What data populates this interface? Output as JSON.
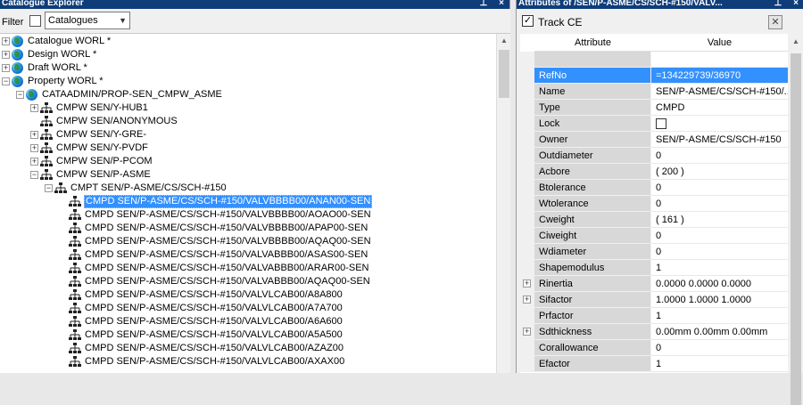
{
  "left_panel": {
    "title": "Catalogue Explorer",
    "pin_glyph": "⊥",
    "close_glyph": "×",
    "filter_label": "Filter",
    "filter_dropdown_value": "Catalogues",
    "tree": [
      {
        "label": "Catalogue WORL *",
        "icon": "globe",
        "expander": "+"
      },
      {
        "label": "Design WORL *",
        "icon": "globe",
        "expander": "+"
      },
      {
        "label": "Draft WORL *",
        "icon": "globe",
        "expander": "+"
      },
      {
        "label": "Property WORL *",
        "icon": "globe",
        "expander": "−"
      },
      {
        "label": "CATAADMIN/PROP-SEN_CMPW_ASME",
        "icon": "globe",
        "expander": "−"
      },
      {
        "label": "CMPW SEN/Y-HUB1",
        "icon": "hierarchy",
        "expander": "+"
      },
      {
        "label": "CMPW SEN/ANONYMOUS",
        "icon": "hierarchy",
        "expander": ""
      },
      {
        "label": "CMPW SEN/Y-GRE-",
        "icon": "hierarchy",
        "expander": "+"
      },
      {
        "label": "CMPW SEN/Y-PVDF",
        "icon": "hierarchy",
        "expander": "+"
      },
      {
        "label": "CMPW SEN/P-PCOM",
        "icon": "hierarchy",
        "expander": "+"
      },
      {
        "label": "CMPW SEN/P-ASME",
        "icon": "hierarchy",
        "expander": "−"
      },
      {
        "label": "CMPT SEN/P-ASME/CS/SCH-#150",
        "icon": "hierarchy",
        "expander": "−"
      },
      {
        "label": "CMPD SEN/P-ASME/CS/SCH-#150/VALVBBBB00/ANAN00-SEN",
        "icon": "hierarchy",
        "expander": "",
        "selected": true
      },
      {
        "label": "CMPD SEN/P-ASME/CS/SCH-#150/VALVBBBB00/AOAO00-SEN",
        "icon": "hierarchy",
        "expander": ""
      },
      {
        "label": "CMPD SEN/P-ASME/CS/SCH-#150/VALVBBBB00/APAP00-SEN",
        "icon": "hierarchy",
        "expander": ""
      },
      {
        "label": "CMPD SEN/P-ASME/CS/SCH-#150/VALVBBBB00/AQAQ00-SEN",
        "icon": "hierarchy",
        "expander": ""
      },
      {
        "label": "CMPD SEN/P-ASME/CS/SCH-#150/VALVABBB00/ASAS00-SEN",
        "icon": "hierarchy",
        "expander": ""
      },
      {
        "label": "CMPD SEN/P-ASME/CS/SCH-#150/VALVABBB00/ARAR00-SEN",
        "icon": "hierarchy",
        "expander": ""
      },
      {
        "label": "CMPD SEN/P-ASME/CS/SCH-#150/VALVABBB00/AQAQ00-SEN",
        "icon": "hierarchy",
        "expander": ""
      },
      {
        "label": "CMPD SEN/P-ASME/CS/SCH-#150/VALVLCAB00/A8A800",
        "icon": "hierarchy",
        "expander": ""
      },
      {
        "label": "CMPD SEN/P-ASME/CS/SCH-#150/VALVLCAB00/A7A700",
        "icon": "hierarchy",
        "expander": ""
      },
      {
        "label": "CMPD SEN/P-ASME/CS/SCH-#150/VALVLCAB00/A6A600",
        "icon": "hierarchy",
        "expander": ""
      },
      {
        "label": "CMPD SEN/P-ASME/CS/SCH-#150/VALVLCAB00/A5A500",
        "icon": "hierarchy",
        "expander": ""
      },
      {
        "label": "CMPD SEN/P-ASME/CS/SCH-#150/VALVLCAB00/AZAZ00",
        "icon": "hierarchy",
        "expander": ""
      },
      {
        "label": "CMPD SEN/P-ASME/CS/SCH-#150/VALVLCAB00/AXAX00",
        "icon": "hierarchy",
        "expander": ""
      }
    ]
  },
  "right_panel": {
    "title": "Attributes of /SEN/P-ASME/CS/SCH-#150/VALV...",
    "pin_glyph": "⊥",
    "close_glyph": "×",
    "track_ce_label": "Track CE",
    "track_ce_checked": "✓",
    "clear_icon": "✕",
    "col_attribute": "Attribute",
    "col_value": "Value",
    "rows": [
      {
        "attr": "",
        "value": ""
      },
      {
        "attr": "RefNo",
        "value": "=134229739/36970",
        "selected": true
      },
      {
        "attr": "Name",
        "value": "SEN/P-ASME/CS/SCH-#150/..."
      },
      {
        "attr": "Type",
        "value": "CMPD"
      },
      {
        "attr": "Lock",
        "value": "",
        "checkbox": true
      },
      {
        "attr": "Owner",
        "value": "SEN/P-ASME/CS/SCH-#150"
      },
      {
        "attr": "Outdiameter",
        "value": "0"
      },
      {
        "attr": "Acbore",
        "value": "( 200 )"
      },
      {
        "attr": "Btolerance",
        "value": "0"
      },
      {
        "attr": "Wtolerance",
        "value": "0"
      },
      {
        "attr": "Cweight",
        "value": "( 161 )"
      },
      {
        "attr": "Ciweight",
        "value": "0"
      },
      {
        "attr": "Wdiameter",
        "value": "0"
      },
      {
        "attr": "Shapemodulus",
        "value": "1"
      },
      {
        "attr": "Rinertia",
        "value": "0.0000 0.0000 0.0000",
        "expand": true
      },
      {
        "attr": "Sifactor",
        "value": "1.0000 1.0000 1.0000",
        "expand": true
      },
      {
        "attr": "Prfactor",
        "value": "1"
      },
      {
        "attr": "Sdthickness",
        "value": "0.00mm 0.00mm 0.00mm",
        "expand": true
      },
      {
        "attr": "Corallowance",
        "value": "0"
      },
      {
        "attr": "Efactor",
        "value": "1"
      }
    ]
  },
  "colors": {
    "title_bar": "#0f3d7a",
    "selection": "#3390ff",
    "attr_cell": "#d8d8d8"
  }
}
